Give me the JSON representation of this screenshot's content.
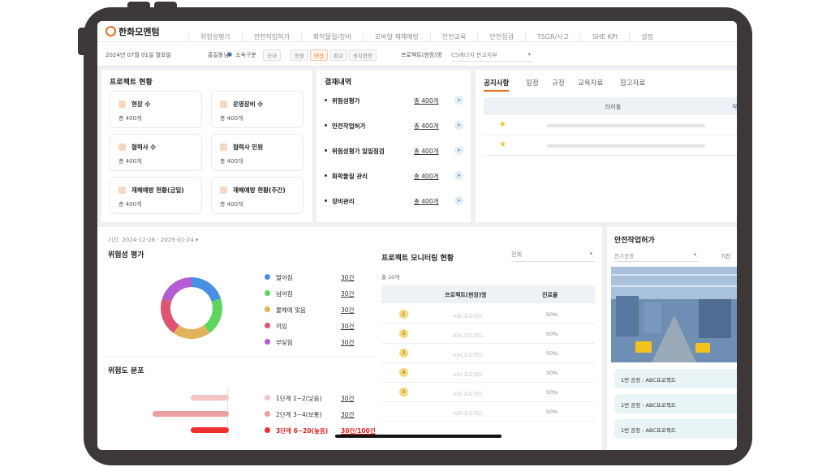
{
  "brand": {
    "name": "한화모멘텀",
    "accent": "#f26b1d"
  },
  "menu": [
    "위험성평가",
    "안전작업허가",
    "화학물질/장비",
    "모바일 재해예방",
    "안전교육",
    "안전점검",
    "TSGR/사고",
    "SHE KPI",
    "설정"
  ],
  "subbar": {
    "date": "2024년 07월 01일 월요일",
    "user": "홍길동님",
    "dept_label": "소속구분",
    "dept_value": "국내",
    "chips": [
      "창원",
      "아산",
      "판교",
      "성지현장"
    ],
    "project_label": "프로젝트(현장)명",
    "project_value": "CS에너지 판교지부"
  },
  "project_status": {
    "title": "프로젝트 현황",
    "tiles": [
      {
        "label": "현장 수",
        "value": "총 400개"
      },
      {
        "label": "운영장비 수",
        "value": "총 400개"
      },
      {
        "label": "협력사 수",
        "value": "총 400개"
      },
      {
        "label": "협력사 인원",
        "value": "총 400개"
      },
      {
        "label": "재해예방 현황(금일)",
        "value": "총 400개"
      },
      {
        "label": "재해예방 현황(주간)",
        "value": "총 400개"
      }
    ]
  },
  "approvals": {
    "title": "결재내역",
    "items": [
      {
        "label": "위험성평가",
        "count": "총 400개"
      },
      {
        "label": "안전작업허가",
        "count": "총 400개"
      },
      {
        "label": "위험성평가 일일점검",
        "count": "총 400개"
      },
      {
        "label": "화학물질 관리",
        "count": "총 400개"
      },
      {
        "label": "장비관리",
        "count": "총 400개"
      }
    ]
  },
  "notice": {
    "tabs": [
      "공지사항",
      "일정",
      "규정",
      "교육자료",
      "참고자료"
    ],
    "column": "타이틀",
    "column2": "작"
  },
  "period": {
    "label": "기간",
    "value": "2024-12-28 - 2025-01-24"
  },
  "risk": {
    "title": "위험성 평가",
    "legend": [
      {
        "label": "떨어짐",
        "count": "30건",
        "color": "#4a90e2",
        "value": 30
      },
      {
        "label": "넘어짐",
        "count": "30건",
        "color": "#5cd65c",
        "value": 30
      },
      {
        "label": "물체에 맞음",
        "count": "30건",
        "color": "#e0b45a",
        "value": 30
      },
      {
        "label": "끼임",
        "count": "30건",
        "color": "#e05470",
        "value": 30
      },
      {
        "label": "부딪힘",
        "count": "30건",
        "color": "#b45cd6",
        "value": 30
      }
    ]
  },
  "distribution": {
    "title": "위험도 분포",
    "items": [
      {
        "label": "1단계 1~2(낮음)",
        "count": "30건",
        "color": "#f6c4c4",
        "value": 30
      },
      {
        "label": "2단계 3~4(보통)",
        "count": "30건",
        "color": "#eba0a0",
        "value": 60
      },
      {
        "label": "3단계 6~20(높음)",
        "count": "30건/100건",
        "color": "#f0302e",
        "value": 30
      }
    ]
  },
  "monitoring": {
    "title": "프로젝트 모니터링 현황",
    "filter": "전체",
    "total": "총 10개",
    "col_name": "프로젝트(현장)명",
    "col_rate": "진료율",
    "rows": [
      {
        "num": "1",
        "name": "ABC프로젝트",
        "rate": "50%"
      },
      {
        "num": "2",
        "name": "ABC프로젝트",
        "rate": "50%"
      },
      {
        "num": "3",
        "name": "ABC프로젝트",
        "rate": "50%"
      },
      {
        "num": "4",
        "name": "ABC프로젝트",
        "rate": "50%"
      },
      {
        "num": "5",
        "name": "ABC프로젝트",
        "rate": "50%"
      },
      {
        "num": "",
        "name": "ABC프로젝트",
        "rate": "50%"
      }
    ]
  },
  "permit": {
    "title": "안전작업허가",
    "select": "전기공정",
    "period_label": "기간",
    "rows": [
      "1번 공정 : ABC프로젝트",
      "1번 공정 : ABC프로젝트",
      "1번 공정 : ABC프로젝트"
    ]
  }
}
